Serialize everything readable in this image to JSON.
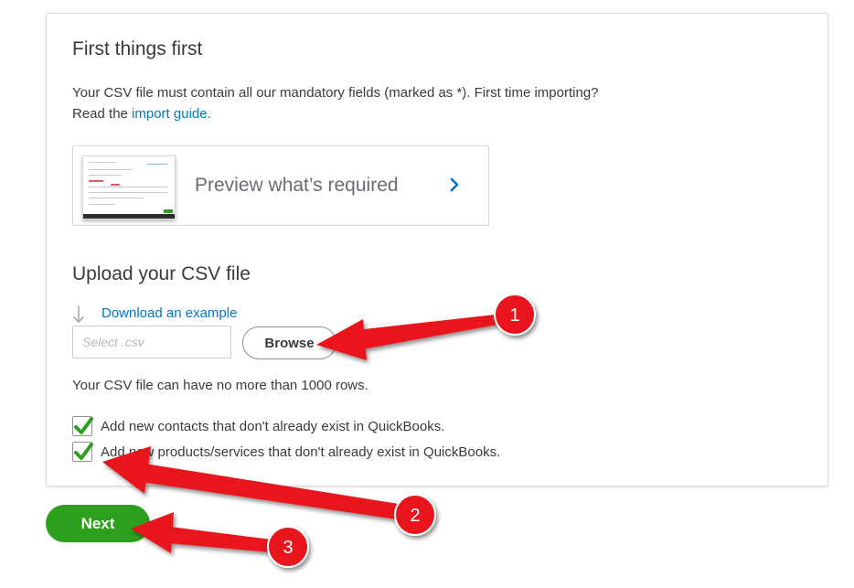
{
  "section1": {
    "title": "First things first",
    "desc_line1": "Your CSV file must contain all our mandatory fields (marked as *). First time importing?",
    "desc_line2_prefix": "Read the ",
    "import_guide_link": "import guide",
    "desc_line2_suffix": "."
  },
  "preview": {
    "label": "Preview what’s required",
    "chevron_icon": "chevron-right-icon"
  },
  "section2": {
    "title": "Upload your CSV file",
    "download_icon": "download-arrow-icon",
    "download_link": "Download an example",
    "file_input_placeholder": "Select .csv",
    "browse_label": "Browse",
    "limit_note": "Your CSV file can have no more than 1000 rows."
  },
  "options": [
    {
      "label": "Add new contacts that don't already exist in QuickBooks.",
      "checked": true
    },
    {
      "label": "Add new products/services that don't already exist in QuickBooks.",
      "checked": true
    }
  ],
  "next_label": "Next",
  "annotations": [
    {
      "number": "1"
    },
    {
      "number": "2"
    },
    {
      "number": "3"
    }
  ],
  "colors": {
    "link": "#0077c5",
    "primary_button": "#2ca01c",
    "checkmark": "#2ca01c",
    "annotation_arrow": "#e8181b"
  }
}
